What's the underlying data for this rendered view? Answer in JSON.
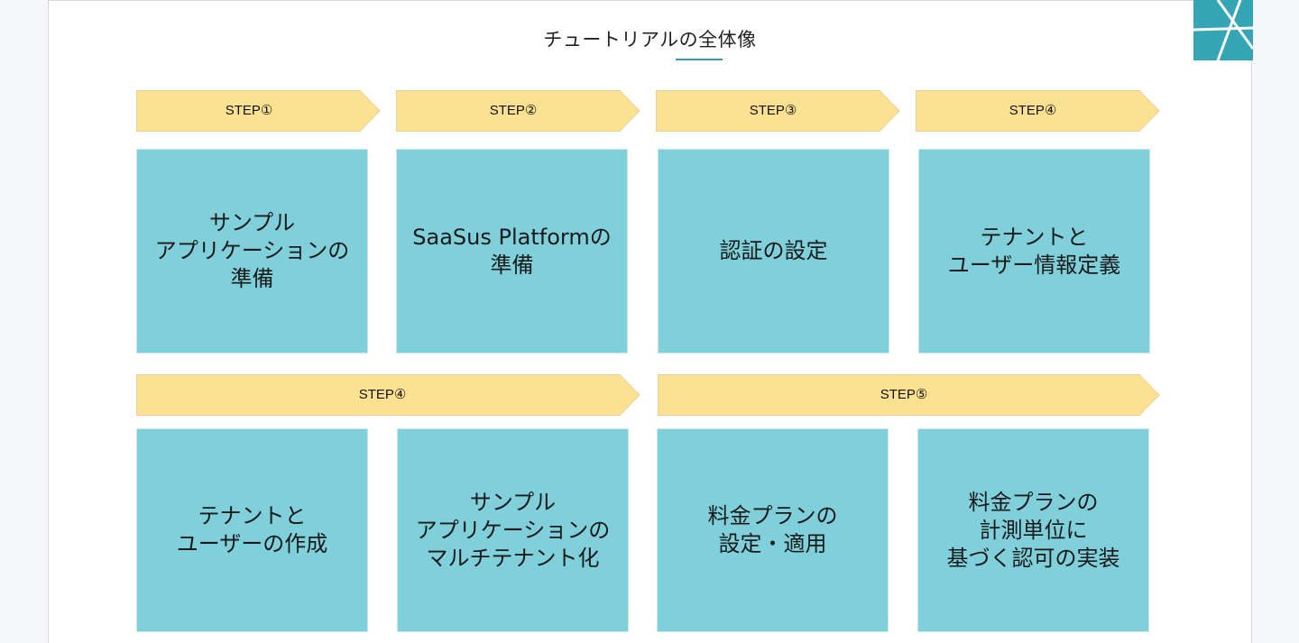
{
  "title": "チュートリアルの全体像",
  "colors": {
    "accent": "#2e9db0",
    "step_fill": "#fde192",
    "box_fill": "#7fd0db",
    "logo_bg": "#35a4b5"
  },
  "row1": {
    "steps": [
      "STEP①",
      "STEP②",
      "STEP③",
      "STEP④"
    ],
    "boxes": [
      "サンプル\nアプリケーションの\n準備",
      "SaaSus Platformの\n準備",
      "認証の設定",
      "テナントと\nユーザー情報定義"
    ]
  },
  "row2": {
    "steps": [
      "STEP④",
      "STEP⑤"
    ],
    "boxes": [
      "テナントと\nユーザーの作成",
      "サンプル\nアプリケーションの\nマルチテナント化",
      "料金プランの\n設定・適用",
      "料金プランの\n計測単位に\n基づく認可の実装"
    ]
  },
  "logo": {
    "icon": "saasus-logo-icon"
  }
}
